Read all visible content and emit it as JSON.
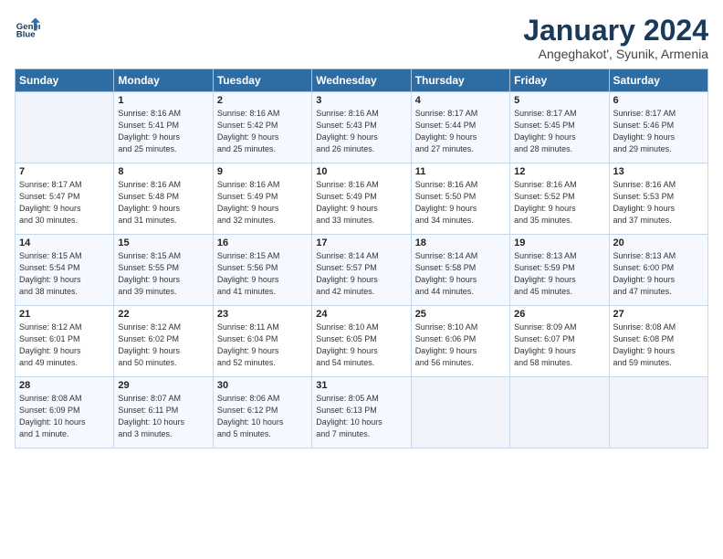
{
  "logo": {
    "line1": "General",
    "line2": "Blue"
  },
  "title": "January 2024",
  "subtitle": "Angeghakot', Syunik, Armenia",
  "days_header": [
    "Sunday",
    "Monday",
    "Tuesday",
    "Wednesday",
    "Thursday",
    "Friday",
    "Saturday"
  ],
  "weeks": [
    [
      {
        "day": "",
        "detail": ""
      },
      {
        "day": "1",
        "detail": "Sunrise: 8:16 AM\nSunset: 5:41 PM\nDaylight: 9 hours\nand 25 minutes."
      },
      {
        "day": "2",
        "detail": "Sunrise: 8:16 AM\nSunset: 5:42 PM\nDaylight: 9 hours\nand 25 minutes."
      },
      {
        "day": "3",
        "detail": "Sunrise: 8:16 AM\nSunset: 5:43 PM\nDaylight: 9 hours\nand 26 minutes."
      },
      {
        "day": "4",
        "detail": "Sunrise: 8:17 AM\nSunset: 5:44 PM\nDaylight: 9 hours\nand 27 minutes."
      },
      {
        "day": "5",
        "detail": "Sunrise: 8:17 AM\nSunset: 5:45 PM\nDaylight: 9 hours\nand 28 minutes."
      },
      {
        "day": "6",
        "detail": "Sunrise: 8:17 AM\nSunset: 5:46 PM\nDaylight: 9 hours\nand 29 minutes."
      }
    ],
    [
      {
        "day": "7",
        "detail": "Sunrise: 8:17 AM\nSunset: 5:47 PM\nDaylight: 9 hours\nand 30 minutes."
      },
      {
        "day": "8",
        "detail": "Sunrise: 8:16 AM\nSunset: 5:48 PM\nDaylight: 9 hours\nand 31 minutes."
      },
      {
        "day": "9",
        "detail": "Sunrise: 8:16 AM\nSunset: 5:49 PM\nDaylight: 9 hours\nand 32 minutes."
      },
      {
        "day": "10",
        "detail": "Sunrise: 8:16 AM\nSunset: 5:49 PM\nDaylight: 9 hours\nand 33 minutes."
      },
      {
        "day": "11",
        "detail": "Sunrise: 8:16 AM\nSunset: 5:50 PM\nDaylight: 9 hours\nand 34 minutes."
      },
      {
        "day": "12",
        "detail": "Sunrise: 8:16 AM\nSunset: 5:52 PM\nDaylight: 9 hours\nand 35 minutes."
      },
      {
        "day": "13",
        "detail": "Sunrise: 8:16 AM\nSunset: 5:53 PM\nDaylight: 9 hours\nand 37 minutes."
      }
    ],
    [
      {
        "day": "14",
        "detail": "Sunrise: 8:15 AM\nSunset: 5:54 PM\nDaylight: 9 hours\nand 38 minutes."
      },
      {
        "day": "15",
        "detail": "Sunrise: 8:15 AM\nSunset: 5:55 PM\nDaylight: 9 hours\nand 39 minutes."
      },
      {
        "day": "16",
        "detail": "Sunrise: 8:15 AM\nSunset: 5:56 PM\nDaylight: 9 hours\nand 41 minutes."
      },
      {
        "day": "17",
        "detail": "Sunrise: 8:14 AM\nSunset: 5:57 PM\nDaylight: 9 hours\nand 42 minutes."
      },
      {
        "day": "18",
        "detail": "Sunrise: 8:14 AM\nSunset: 5:58 PM\nDaylight: 9 hours\nand 44 minutes."
      },
      {
        "day": "19",
        "detail": "Sunrise: 8:13 AM\nSunset: 5:59 PM\nDaylight: 9 hours\nand 45 minutes."
      },
      {
        "day": "20",
        "detail": "Sunrise: 8:13 AM\nSunset: 6:00 PM\nDaylight: 9 hours\nand 47 minutes."
      }
    ],
    [
      {
        "day": "21",
        "detail": "Sunrise: 8:12 AM\nSunset: 6:01 PM\nDaylight: 9 hours\nand 49 minutes."
      },
      {
        "day": "22",
        "detail": "Sunrise: 8:12 AM\nSunset: 6:02 PM\nDaylight: 9 hours\nand 50 minutes."
      },
      {
        "day": "23",
        "detail": "Sunrise: 8:11 AM\nSunset: 6:04 PM\nDaylight: 9 hours\nand 52 minutes."
      },
      {
        "day": "24",
        "detail": "Sunrise: 8:10 AM\nSunset: 6:05 PM\nDaylight: 9 hours\nand 54 minutes."
      },
      {
        "day": "25",
        "detail": "Sunrise: 8:10 AM\nSunset: 6:06 PM\nDaylight: 9 hours\nand 56 minutes."
      },
      {
        "day": "26",
        "detail": "Sunrise: 8:09 AM\nSunset: 6:07 PM\nDaylight: 9 hours\nand 58 minutes."
      },
      {
        "day": "27",
        "detail": "Sunrise: 8:08 AM\nSunset: 6:08 PM\nDaylight: 9 hours\nand 59 minutes."
      }
    ],
    [
      {
        "day": "28",
        "detail": "Sunrise: 8:08 AM\nSunset: 6:09 PM\nDaylight: 10 hours\nand 1 minute."
      },
      {
        "day": "29",
        "detail": "Sunrise: 8:07 AM\nSunset: 6:11 PM\nDaylight: 10 hours\nand 3 minutes."
      },
      {
        "day": "30",
        "detail": "Sunrise: 8:06 AM\nSunset: 6:12 PM\nDaylight: 10 hours\nand 5 minutes."
      },
      {
        "day": "31",
        "detail": "Sunrise: 8:05 AM\nSunset: 6:13 PM\nDaylight: 10 hours\nand 7 minutes."
      },
      {
        "day": "",
        "detail": ""
      },
      {
        "day": "",
        "detail": ""
      },
      {
        "day": "",
        "detail": ""
      }
    ]
  ]
}
